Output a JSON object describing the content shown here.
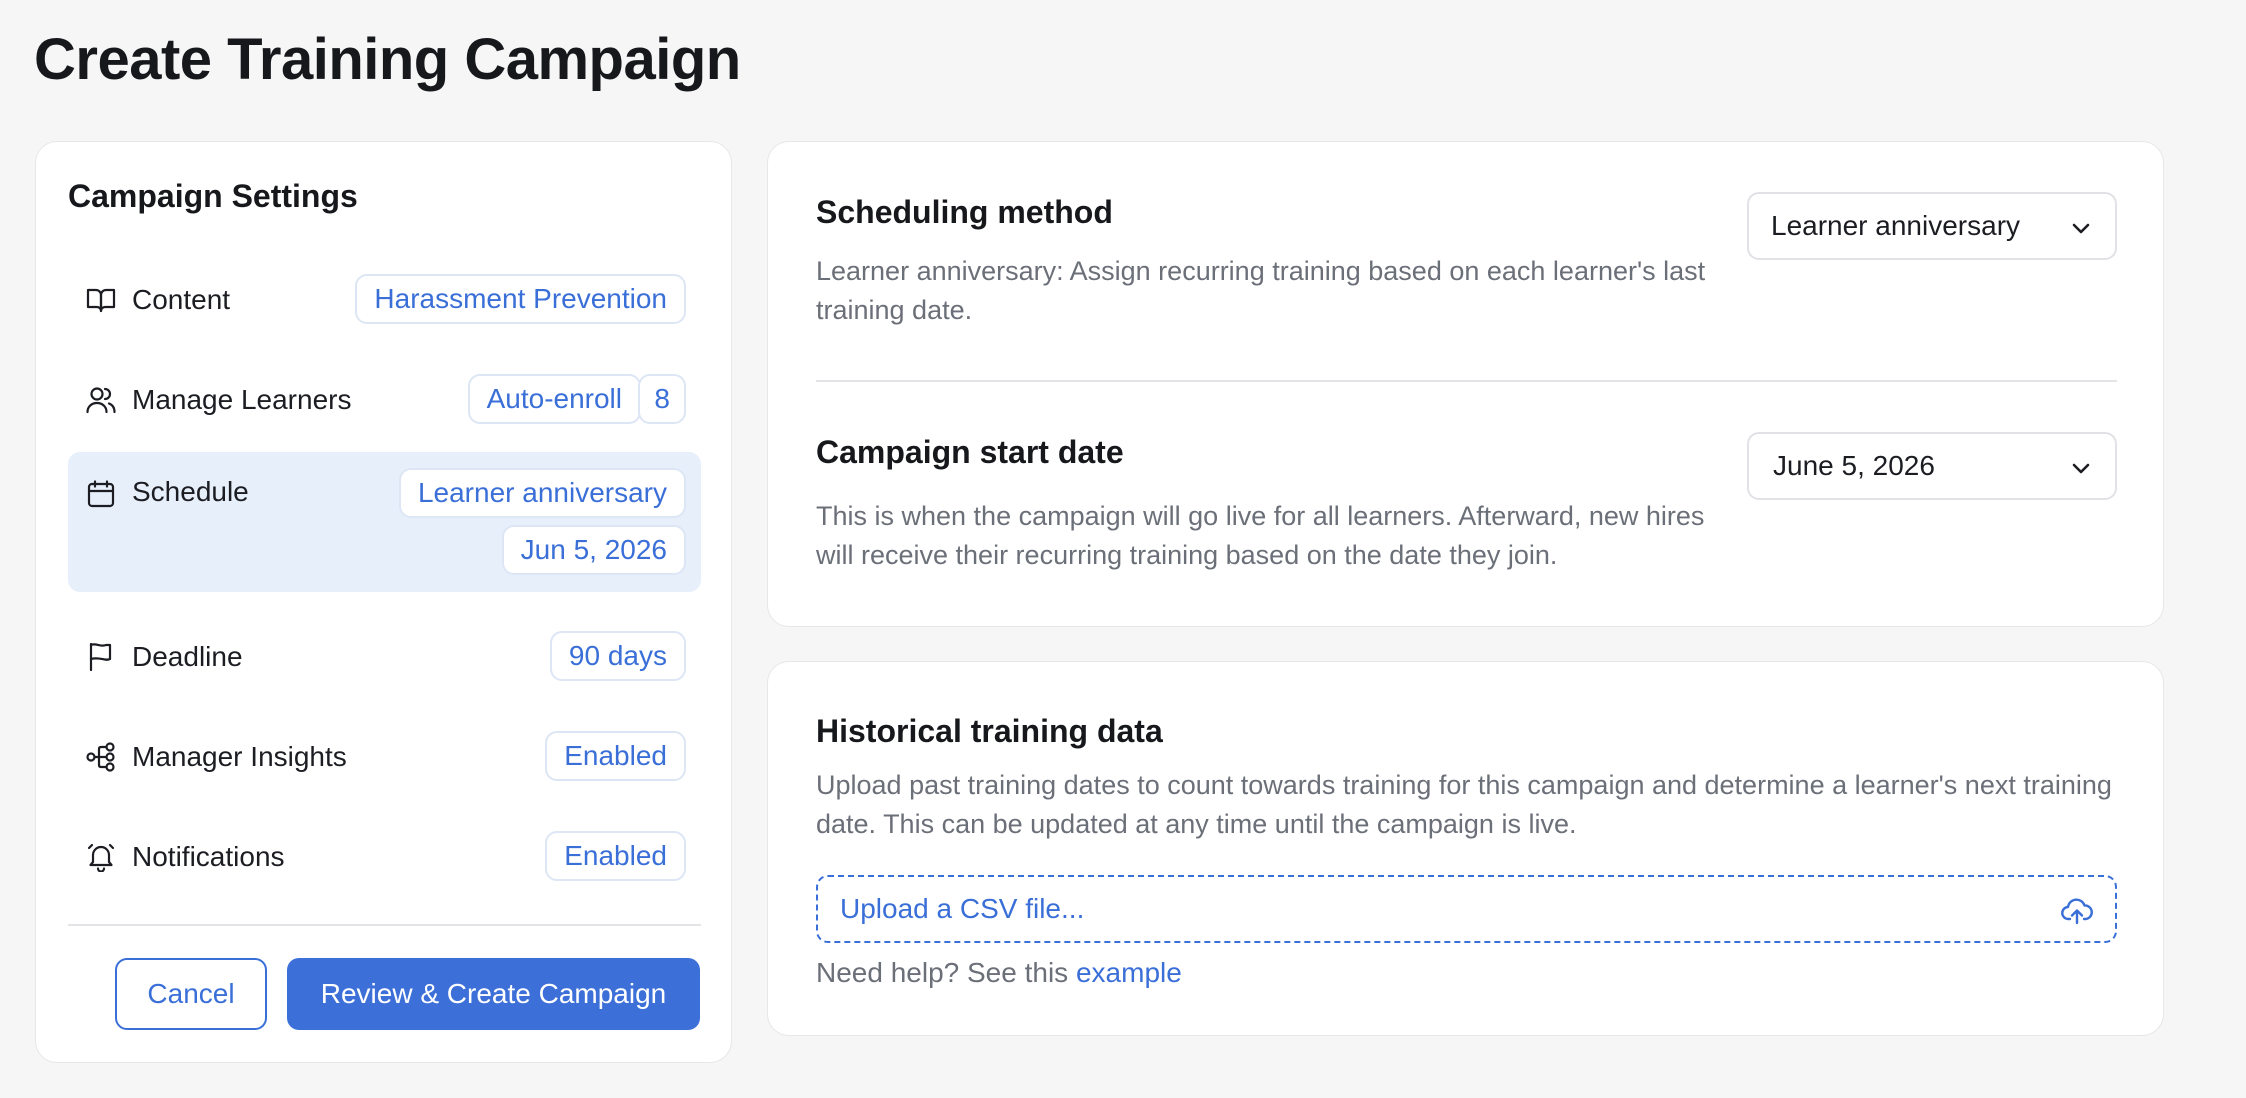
{
  "page": {
    "title": "Create Training Campaign"
  },
  "settings": {
    "title": "Campaign Settings",
    "rows": [
      {
        "label": "Content",
        "icon": "book-icon",
        "badges": [
          "Harassment Prevention"
        ]
      },
      {
        "label": "Manage Learners",
        "icon": "users-icon",
        "badges": [
          "Auto-enroll",
          "8"
        ]
      },
      {
        "label": "Schedule",
        "icon": "calendar-icon",
        "badges": [
          "Learner anniversary",
          "Jun 5, 2026"
        ],
        "active": true
      },
      {
        "label": "Deadline",
        "icon": "flag-icon",
        "badges": [
          "90 days"
        ]
      },
      {
        "label": "Manager Insights",
        "icon": "hierarchy-icon",
        "badges": [
          "Enabled"
        ]
      },
      {
        "label": "Notifications",
        "icon": "bell-icon",
        "badges": [
          "Enabled"
        ]
      }
    ],
    "cancel_label": "Cancel",
    "submit_label": "Review & Create Campaign"
  },
  "scheduling": {
    "title": "Scheduling method",
    "description": "Learner anniversary: Assign recurring training based on each learner's last training date.",
    "selected": "Learner anniversary"
  },
  "start_date": {
    "title": "Campaign start date",
    "description": "This is when the campaign will go live for all learners. Afterward, new hires will receive their recurring training based on the date they join.",
    "selected": "June 5, 2026"
  },
  "historical": {
    "title": "Historical training data",
    "description": "Upload past training dates to count towards training for this campaign and determine a learner's next training date. This can be updated at any time until the campaign is live.",
    "upload_label": "Upload a CSV file...",
    "help_text": "Need help? See this",
    "help_link": "example"
  },
  "colors": {
    "accent": "#3c6fd8",
    "active_row_bg": "#e7effb",
    "page_bg": "#f6f6f6"
  }
}
